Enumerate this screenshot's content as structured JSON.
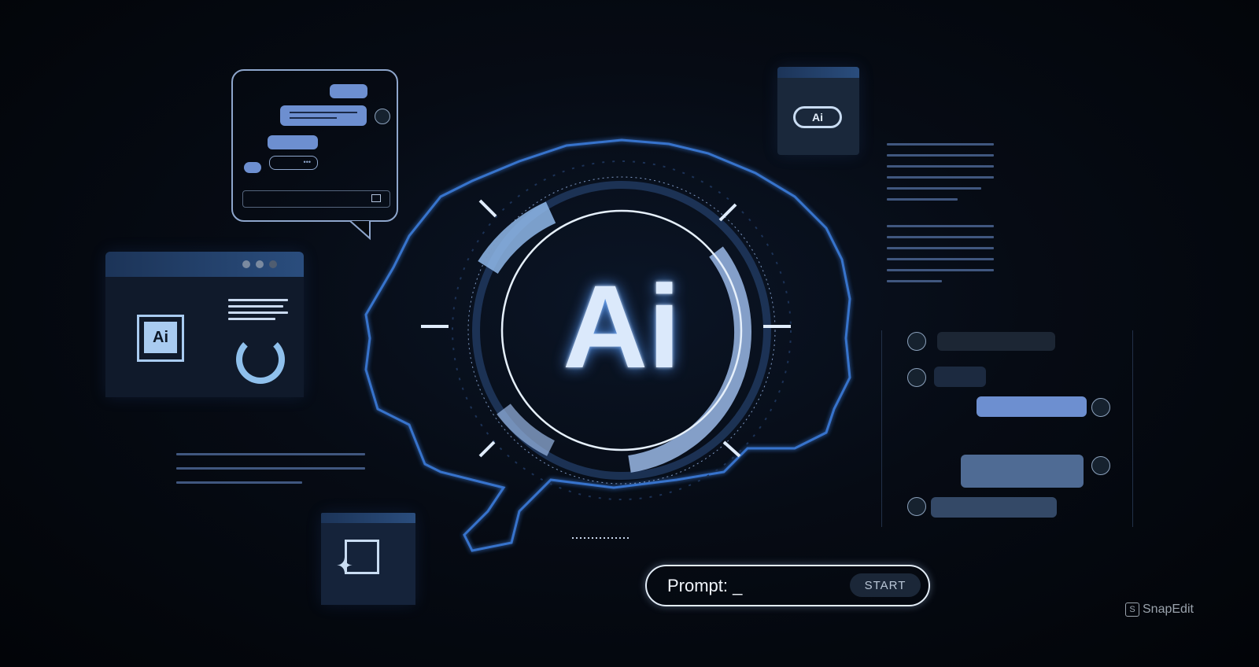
{
  "center": {
    "logo_text": "Ai"
  },
  "chip": {
    "label": "Ai"
  },
  "robot": {
    "label": "Ai"
  },
  "prompt": {
    "label": "Prompt:",
    "cursor": "_",
    "start_label": "START"
  },
  "watermark": {
    "text": "SnapEdit",
    "logo": "S"
  },
  "colors": {
    "accent": "#4f8fe8",
    "bubble": "#6d8fd0",
    "background": "#05090f"
  },
  "icons": [
    "chat-bubble-icon",
    "robot-icon",
    "send-icon",
    "cpu-chip-icon",
    "loading-ring-icon",
    "image-sparkle-icon",
    "user-avatar-icon",
    "eye-icon"
  ]
}
